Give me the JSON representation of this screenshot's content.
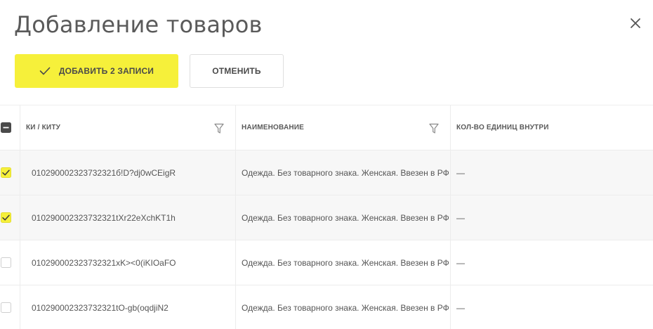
{
  "modal": {
    "title": "Добавление товаров"
  },
  "toolbar": {
    "add_label": "ДОБАВИТЬ 2 ЗАПИСИ",
    "cancel_label": "ОТМЕНИТЬ"
  },
  "table": {
    "select_all_state": "indeterminate",
    "columns": [
      {
        "label": "КИ / КИТУ",
        "filterable": true
      },
      {
        "label": "НАИМЕНОВАНИЕ",
        "filterable": true
      },
      {
        "label": "КОЛ-ВО ЕДИНИЦ ВНУТРИ",
        "filterable": false
      }
    ],
    "rows": [
      {
        "checked": true,
        "code": "010290002323732321б!D?dj0wCEigR",
        "name": "Одежда. Без товарного знака. Женская. Ввезен в РФ",
        "qty": "—"
      },
      {
        "checked": true,
        "code": "010290002323732321tXr22eXchKT1h",
        "name": "Одежда. Без товарного знака. Женская. Ввезен в РФ",
        "qty": "—"
      },
      {
        "checked": false,
        "code": "010290002323732321xK><0(iKIOaFO",
        "name": "Одежда. Без товарного знака. Женская. Ввезен в РФ",
        "qty": "—"
      },
      {
        "checked": false,
        "code": "010290002323732321tO-gb(oqdjiN2",
        "name": "Одежда. Без товарного знака. Женская. Ввезен в РФ",
        "qty": "—"
      }
    ]
  },
  "colors": {
    "accent": "#f6f03a",
    "row_alt": "#f7f7f7",
    "border": "#ececec"
  },
  "icons": {
    "close": "close-icon",
    "check": "check-icon",
    "filter": "filter-icon"
  }
}
